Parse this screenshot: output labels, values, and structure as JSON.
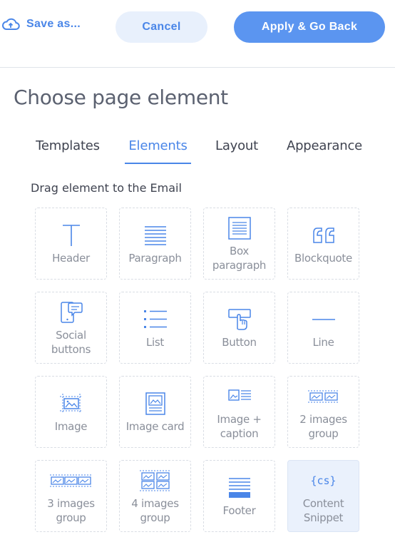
{
  "toolbar": {
    "save_as": "Save as...",
    "cancel": "Cancel",
    "apply": "Apply & Go Back"
  },
  "page": {
    "title": "Choose page element"
  },
  "tabs": [
    {
      "label": "Templates",
      "active": false
    },
    {
      "label": "Elements",
      "active": true
    },
    {
      "label": "Layout",
      "active": false
    },
    {
      "label": "Appearance",
      "active": false
    }
  ],
  "hint": "Drag element to the Email",
  "elements": [
    {
      "label": "Header",
      "icon": "header-icon"
    },
    {
      "label": "Paragraph",
      "icon": "paragraph-icon"
    },
    {
      "label": "Box\nparagraph",
      "icon": "box-paragraph-icon"
    },
    {
      "label": "Blockquote",
      "icon": "blockquote-icon"
    },
    {
      "label": "Social\nbuttons",
      "icon": "social-buttons-icon"
    },
    {
      "label": "List",
      "icon": "list-icon"
    },
    {
      "label": "Button",
      "icon": "button-icon"
    },
    {
      "label": "Line",
      "icon": "line-icon"
    },
    {
      "label": "Image",
      "icon": "image-icon"
    },
    {
      "label": "Image card",
      "icon": "image-card-icon"
    },
    {
      "label": "Image +\ncaption",
      "icon": "image-caption-icon"
    },
    {
      "label": "2 images\ngroup",
      "icon": "two-images-icon"
    },
    {
      "label": "3 images\ngroup",
      "icon": "three-images-icon"
    },
    {
      "label": "4 images\ngroup",
      "icon": "four-images-icon"
    },
    {
      "label": "Footer",
      "icon": "footer-icon"
    },
    {
      "label": "Content\nSnippet",
      "icon": "content-snippet-icon",
      "icon_text": "{cs}"
    }
  ],
  "colors": {
    "accent": "#4a86e8",
    "apply_bg": "#5b95f0",
    "cancel_bg": "#e8f0fc",
    "snippet_bg": "#eaf1fc"
  }
}
